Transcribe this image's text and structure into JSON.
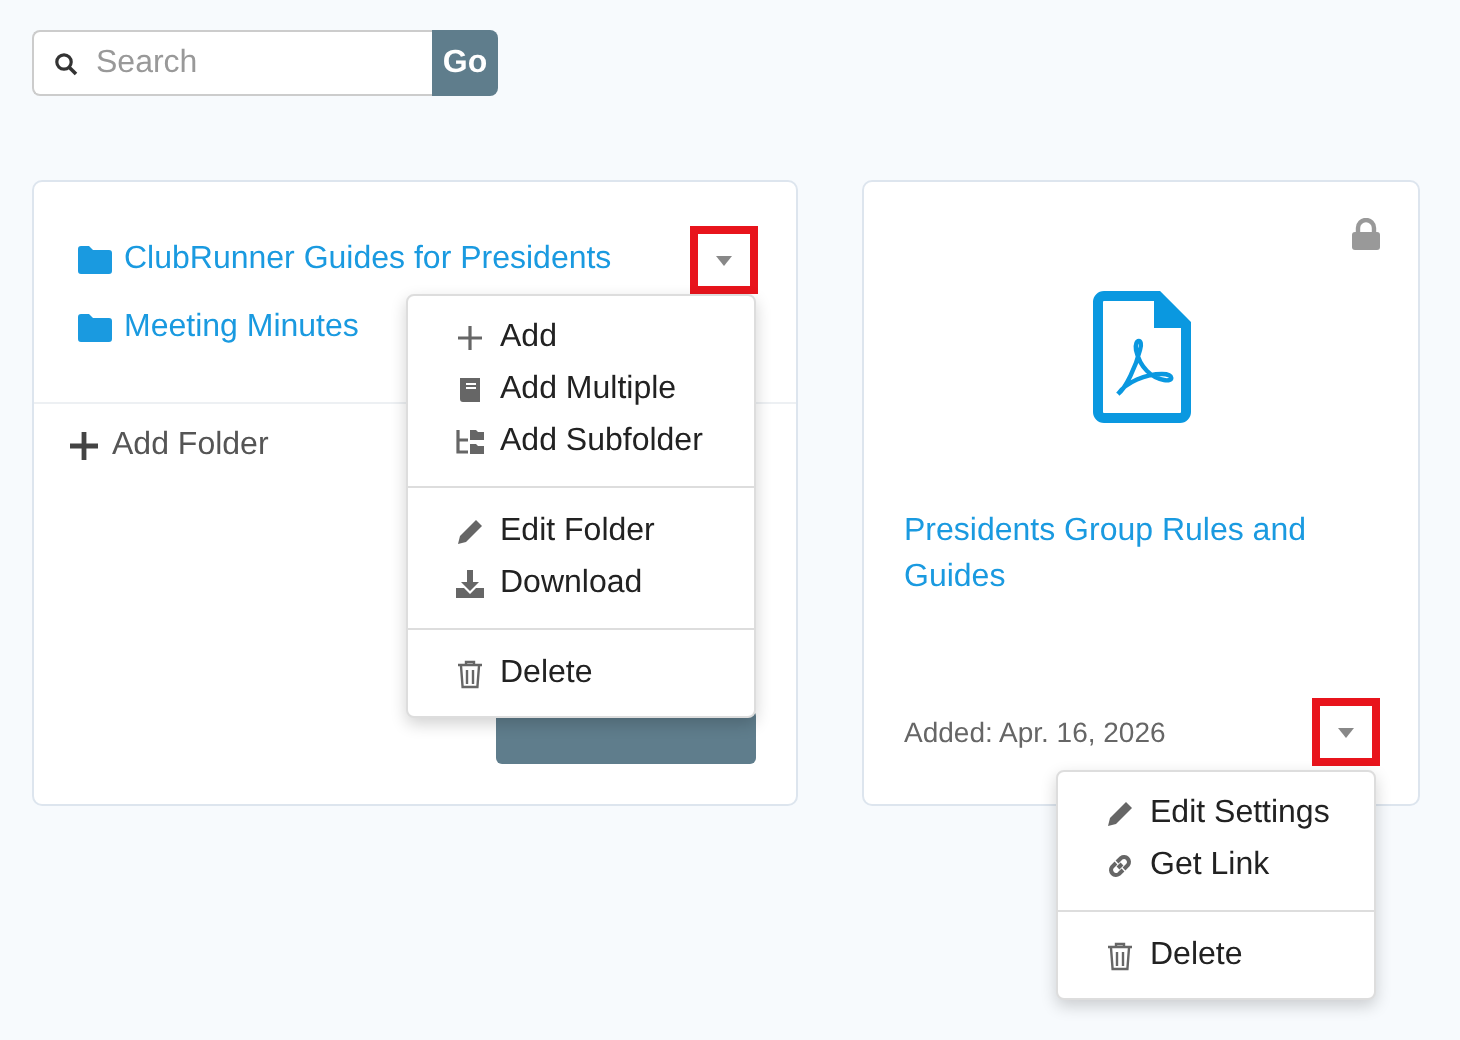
{
  "search": {
    "placeholder": "Search",
    "button": "Go"
  },
  "folder_card": {
    "folders": [
      {
        "name": "ClubRunner Guides for Presidents"
      },
      {
        "name": "Meeting Minutes"
      }
    ],
    "caret_highlighted": true,
    "add_folder": "Add Folder",
    "menu": [
      [
        {
          "kind": "add",
          "label": "Add"
        },
        {
          "kind": "add-multiple",
          "label": "Add Multiple"
        },
        {
          "kind": "add-subfolder",
          "label": "Add Subfolder"
        }
      ],
      [
        {
          "kind": "edit",
          "label": "Edit Folder"
        },
        {
          "kind": "download",
          "label": "Download"
        }
      ],
      [
        {
          "kind": "delete",
          "label": "Delete"
        }
      ]
    ]
  },
  "file_card": {
    "locked": true,
    "title": "Presidents Group Rules and Guides",
    "added": "Added: Apr. 16, 2026",
    "caret_highlighted": true,
    "menu": [
      [
        {
          "kind": "edit",
          "label": "Edit Settings"
        },
        {
          "kind": "link",
          "label": "Get Link"
        }
      ],
      [
        {
          "kind": "delete",
          "label": "Delete"
        }
      ]
    ]
  }
}
